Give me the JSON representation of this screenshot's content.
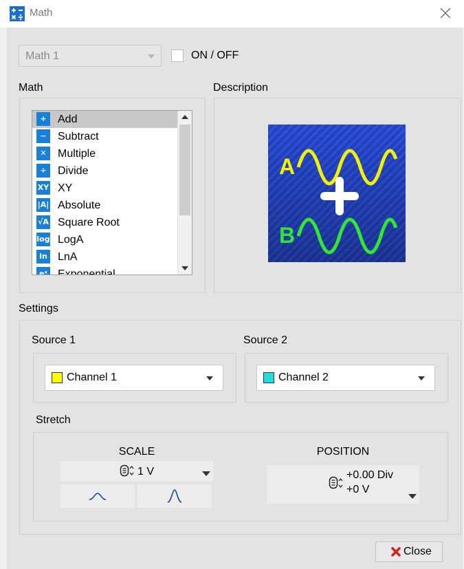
{
  "window": {
    "title": "Math",
    "icon": "calculator-icon",
    "close_icon": "close-icon"
  },
  "top": {
    "math_select_value": "Math 1",
    "onoff_label": "ON / OFF",
    "onoff_checked": false
  },
  "math_section": {
    "label": "Math",
    "items": [
      {
        "label": "Add",
        "icon": "add-icon",
        "glyph": "+"
      },
      {
        "label": "Subtract",
        "icon": "subtract-icon",
        "glyph": "−"
      },
      {
        "label": "Multiple",
        "icon": "multiply-icon",
        "glyph": "✕"
      },
      {
        "label": "Divide",
        "icon": "divide-icon",
        "glyph": "÷"
      },
      {
        "label": "XY",
        "icon": "xy-icon",
        "glyph": "XY"
      },
      {
        "label": "Absolute",
        "icon": "absolute-icon",
        "glyph": "|A|"
      },
      {
        "label": "Square Root",
        "icon": "square-root-icon",
        "glyph": "√A"
      },
      {
        "label": "LogA",
        "icon": "log-icon",
        "glyph": "log"
      },
      {
        "label": "LnA",
        "icon": "ln-icon",
        "glyph": "ln"
      },
      {
        "label": "Exponential",
        "icon": "exponential-icon",
        "glyph": "eˣ"
      }
    ],
    "selected_index": 0
  },
  "description": {
    "label": "Description",
    "image": {
      "a_label": "A",
      "b_label": "B",
      "operator": "+",
      "a_color": "#f2f200",
      "b_color": "#33e633",
      "bg_color": "#2443c8"
    }
  },
  "settings": {
    "label": "Settings",
    "source1": {
      "label": "Source 1",
      "value": "Channel 1",
      "color": "#ffff00"
    },
    "source2": {
      "label": "Source 2",
      "value": "Channel 2",
      "color": "#22dddd"
    },
    "stretch": {
      "label": "Stretch",
      "scale_label": "SCALE",
      "scale_value": "1 V",
      "position_label": "POSITION",
      "position_div": "+0.00 Div",
      "position_v": "+0 V"
    }
  },
  "footer": {
    "close_label": "Close"
  }
}
